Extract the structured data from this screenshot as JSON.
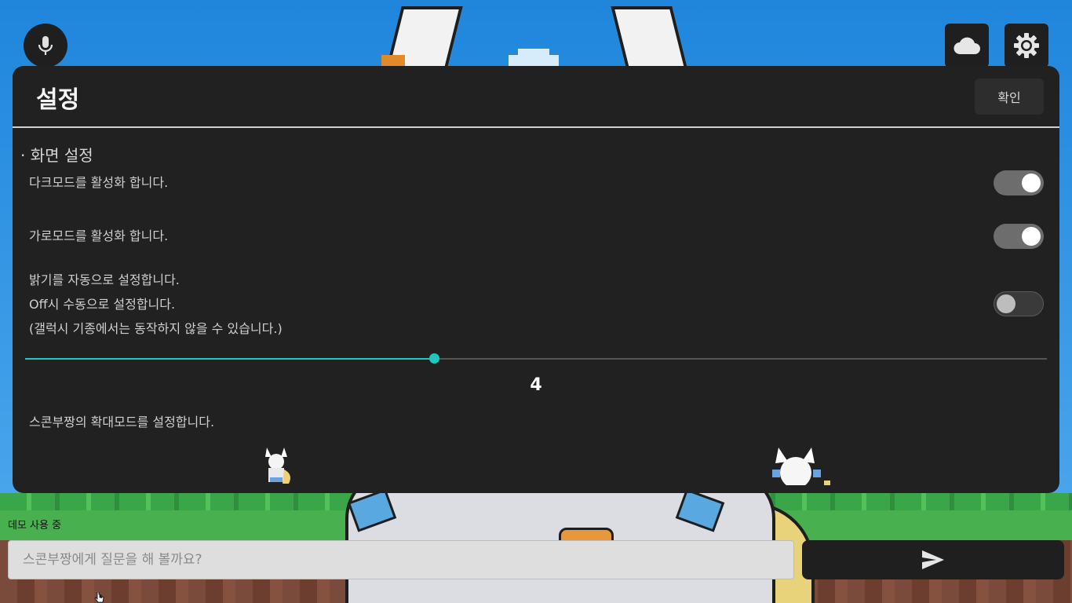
{
  "panel": {
    "title": "설정",
    "confirm_label": "확인",
    "section_title": "· 화면 설정",
    "dark_mode": {
      "label": "다크모드를 활성화 합니다.",
      "enabled": true
    },
    "landscape_mode": {
      "label": "가로모드를 활성화 합니다.",
      "enabled": true
    },
    "auto_brightness": {
      "lines": [
        "밝기를 자동으로 설정합니다.",
        "Off시 수동으로 설정합니다.",
        "(갤럭시 기종에서는 동작하지 않을 수 있습니다.)"
      ],
      "enabled": false
    },
    "brightness_slider": {
      "value": "4",
      "fraction": 0.4
    },
    "zoom_mode_label": "스콘부짱의 확대모드를 설정합니다."
  },
  "top_buttons": {
    "mic": "mic-icon",
    "cloud": "cloud-icon",
    "settings": "gear-icon"
  },
  "bottom": {
    "demo_label": "데모 사용 중",
    "chat_placeholder": "스콘부짱에게 질문을 해 볼까요?",
    "send_icon": "send-icon"
  },
  "colors": {
    "panel_bg": "#212121",
    "accent": "#1ec7c0",
    "toggle_on_track": "#6d6d6d"
  }
}
